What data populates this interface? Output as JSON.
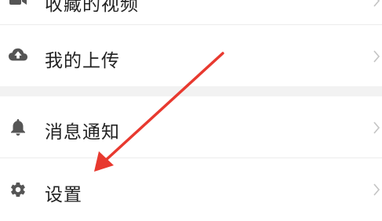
{
  "menu": {
    "items": [
      {
        "label": "收藏的视频",
        "icon": "video-icon"
      },
      {
        "label": "我的上传",
        "icon": "cloud-upload-icon"
      },
      {
        "label": "消息通知",
        "icon": "bell-icon"
      },
      {
        "label": "设置",
        "icon": "gear-icon"
      }
    ]
  },
  "colors": {
    "icon": "#555555",
    "text": "#222222",
    "chevron": "#c4c4c4",
    "divider": "#ececec",
    "section_gap": "#f2f2f2",
    "annotation_arrow": "#e8392f"
  }
}
